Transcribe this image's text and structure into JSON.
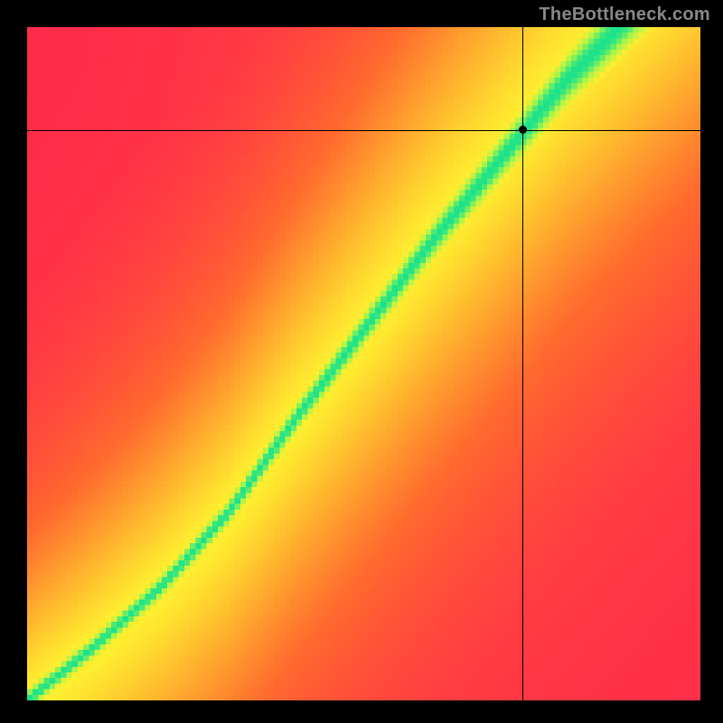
{
  "attribution": "TheBottleneck.com",
  "chart_data": {
    "type": "heatmap",
    "title": "",
    "xlabel": "",
    "ylabel": "",
    "xlim": [
      0,
      1
    ],
    "ylim": [
      0,
      1
    ],
    "grid_resolution": 120,
    "crosshair": {
      "x": 0.736,
      "y": 0.847
    },
    "marker": {
      "x": 0.736,
      "y": 0.847
    },
    "optimum_curve": {
      "description": "ridge of value≈1 running diagonally; slightly concave-up, steeper in upper half",
      "points_xy": [
        [
          0.0,
          0.0
        ],
        [
          0.1,
          0.08
        ],
        [
          0.2,
          0.17
        ],
        [
          0.3,
          0.28
        ],
        [
          0.4,
          0.42
        ],
        [
          0.5,
          0.55
        ],
        [
          0.6,
          0.68
        ],
        [
          0.7,
          0.8
        ],
        [
          0.8,
          0.92
        ],
        [
          0.85,
          0.97
        ],
        [
          0.88,
          1.0
        ]
      ]
    },
    "colorscale": {
      "description": "red→orange→yellow→green; value 0 = red, 1 = green",
      "stops": [
        {
          "t": 0.0,
          "hex": "#ff2a4a"
        },
        {
          "t": 0.35,
          "hex": "#ff6a2e"
        },
        {
          "t": 0.6,
          "hex": "#ffb52e"
        },
        {
          "t": 0.8,
          "hex": "#ffee30"
        },
        {
          "t": 0.92,
          "hex": "#a8f54a"
        },
        {
          "t": 1.0,
          "hex": "#19e28c"
        }
      ]
    }
  }
}
